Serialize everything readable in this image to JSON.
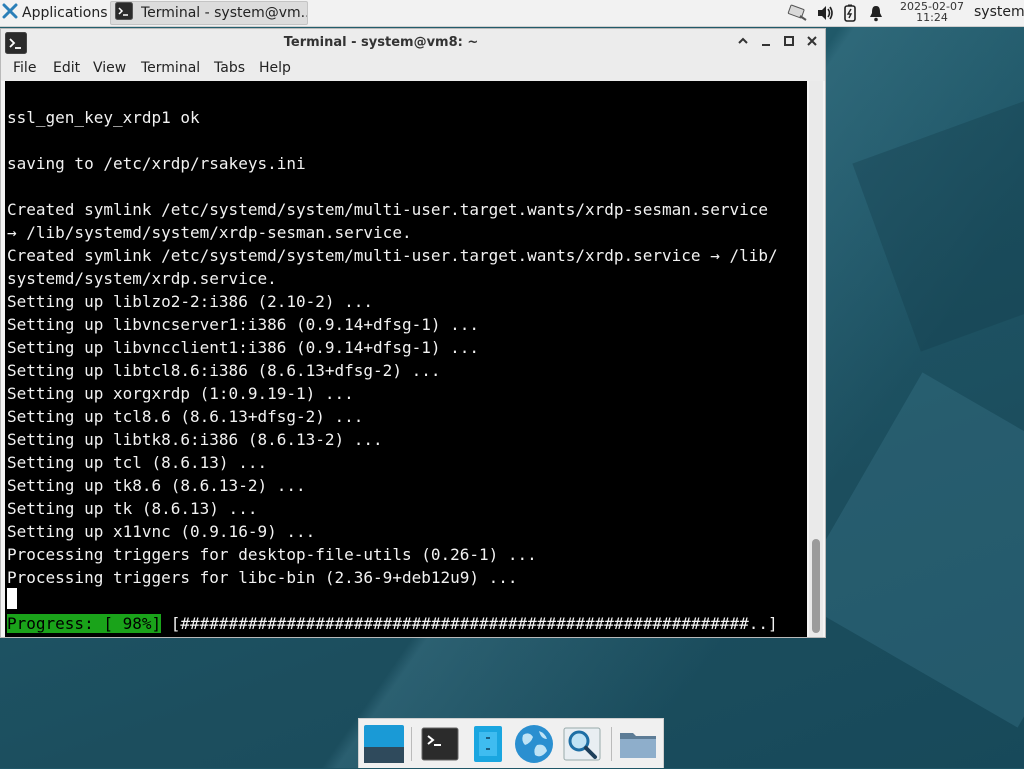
{
  "top_panel": {
    "applications_label": "Applications",
    "task_title": "Terminal - system@vm...",
    "clock_date": "2025-02-07",
    "clock_time": "11:24",
    "user": "system",
    "tray_icons": [
      "network-icon",
      "volume-icon",
      "battery-icon",
      "notification-bell-icon"
    ]
  },
  "window": {
    "title": "Terminal - system@vm8: ~",
    "menu": [
      "File",
      "Edit",
      "View",
      "Terminal",
      "Tabs",
      "Help"
    ]
  },
  "terminal": {
    "lines": [
      "ssl_gen_key_xrdp1 ok",
      "",
      "saving to /etc/xrdp/rsakeys.ini",
      "",
      "Created symlink /etc/systemd/system/multi-user.target.wants/xrdp-sesman.service",
      "→ /lib/systemd/system/xrdp-sesman.service.",
      "Created symlink /etc/systemd/system/multi-user.target.wants/xrdp.service → /lib/",
      "systemd/system/xrdp.service.",
      "Setting up liblzo2-2:i386 (2.10-2) ...",
      "Setting up libvncserver1:i386 (0.9.14+dfsg-1) ...",
      "Setting up libvncclient1:i386 (0.9.14+dfsg-1) ...",
      "Setting up libtcl8.6:i386 (8.6.13+dfsg-2) ...",
      "Setting up xorgxrdp (1:0.9.19-1) ...",
      "Setting up tcl8.6 (8.6.13+dfsg-2) ...",
      "Setting up libtk8.6:i386 (8.6.13-2) ...",
      "Setting up tcl (8.6.13) ...",
      "Setting up tk8.6 (8.6.13-2) ...",
      "Setting up tk (8.6.13) ...",
      "Setting up x11vnc (0.9.16-9) ...",
      "Processing triggers for desktop-file-utils (0.26-1) ...",
      "Processing triggers for libc-bin (2.36-9+deb12u9) ..."
    ],
    "progress_label": "Progress: [ 98%]",
    "progress_bar": " [###########################################################..]",
    "progress_percent": 98
  },
  "dock": {
    "items": [
      "show-desktop-icon",
      "terminal-icon",
      "file-manager-icon",
      "web-browser-icon",
      "app-finder-icon",
      "folder-icon"
    ]
  },
  "colors": {
    "progress_green": "#1aa31a",
    "terminal_bg": "#000000",
    "desktop_bg": "#1f5566"
  }
}
